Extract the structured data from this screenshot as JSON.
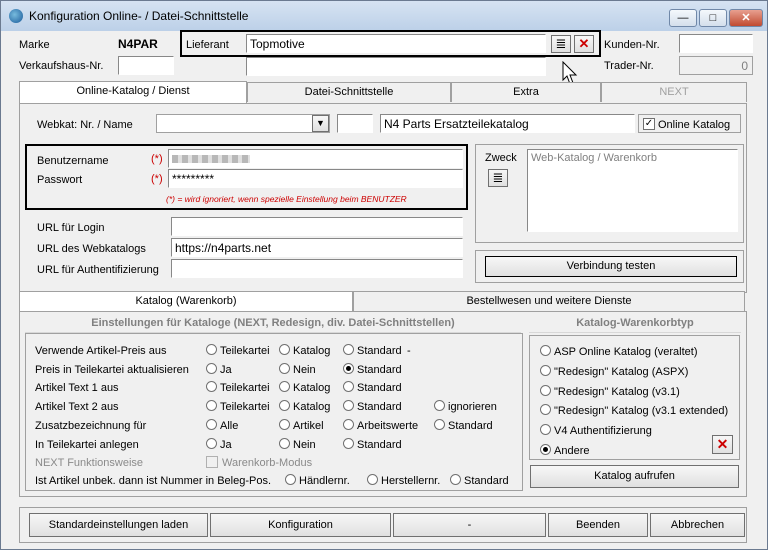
{
  "window": {
    "title": "Konfiguration Online- / Datei-Schnittstelle",
    "min_label": "—",
    "max_label": "□",
    "close_label": "✕"
  },
  "header": {
    "marke_label": "Marke",
    "marke_value": "N4PAR",
    "verkaufshaus_label": "Verkaufshaus-Nr.",
    "lieferant_label": "Lieferant",
    "lieferant_value": "Topmotive",
    "kunden_label": "Kunden-Nr.",
    "trader_label": "Trader-Nr.",
    "trader_value": "0",
    "list_glyph": "≣",
    "clear_glyph": "✕"
  },
  "main_tabs": [
    "Online-Katalog / Dienst",
    "Datei-Schnittstelle",
    "Extra",
    "NEXT"
  ],
  "webkat": {
    "label": "Webkat: Nr. / Name",
    "name_value": "N4 Parts Ersatzteilekatalog",
    "online_label": "Online Katalog",
    "online_checked": true,
    "check_glyph": "✓"
  },
  "auth": {
    "user_label": "Benutzername",
    "user_required": "(*)",
    "pass_label": "Passwort",
    "pass_required": "(*)",
    "pass_value": "*********",
    "note": "(*) = wird ignoriert, wenn spezielle Einstellung beim BENUTZER"
  },
  "zweck": {
    "label": "Zweck",
    "value": "Web-Katalog / Warenkorb"
  },
  "urls": {
    "login_label": "URL für Login",
    "webkat_label": "URL des Webkatalogs",
    "webkat_value": "https://n4parts.net",
    "auth_label": "URL für Authentifizierung"
  },
  "verbindung_label": "Verbindung testen",
  "sub_tabs": [
    "Katalog (Warenkorb)",
    "Bestellwesen und weitere Dienste"
  ],
  "settings": {
    "heading": "Einstellungen für Kataloge (NEXT, Redesign, div. Datei-Schnittstellen)",
    "rows": [
      {
        "label": "Verwende Artikel-Preis aus",
        "options": [
          "Teilekartei",
          "Katalog",
          "Standard"
        ],
        "extra": "-"
      },
      {
        "label": "Preis in Teilekartei aktualisieren",
        "options": [
          "Ja",
          "Nein",
          "Standard"
        ]
      },
      {
        "label": "Artikel Text 1 aus",
        "options": [
          "Teilekartei",
          "Katalog",
          "Standard"
        ]
      },
      {
        "label": "Artikel Text 2 aus",
        "options": [
          "Teilekartei",
          "Katalog",
          "Standard",
          "ignorieren"
        ]
      },
      {
        "label": "Zusatzbezeichnung für",
        "options": [
          "Alle",
          "Artikel",
          "Arbeitswerte",
          "Standard"
        ]
      },
      {
        "label": "In Teilekartei anlegen",
        "options": [
          "Ja",
          "Nein",
          "Standard"
        ]
      }
    ],
    "next_label": "NEXT Funktionsweise",
    "warenkorb_modus_label": "Warenkorb-Modus",
    "unbek_label": "Ist Artikel unbek. dann ist Nummer in Beleg-Pos.",
    "unbek_options": [
      "Händlernr.",
      "Herstellernr.",
      "Standard"
    ]
  },
  "katalog_typ": {
    "heading": "Katalog-Warenkorbtyp",
    "options": [
      "ASP Online Katalog (veraltet)",
      "\"Redesign\" Katalog (ASPX)",
      "\"Redesign\" Katalog (v3.1)",
      "\"Redesign\" Katalog (v3.1 extended)",
      "V4 Authentifizierung",
      "Andere"
    ],
    "selected": "Andere",
    "delete_glyph": "✕"
  },
  "katalog_aufrufen_label": "Katalog aufrufen",
  "footer": {
    "standard_label": "Standardeinstellungen laden",
    "konfig_label": "Konfiguration",
    "dash_label": "-",
    "beenden_label": "Beenden",
    "abbrechen_label": "Abbrechen"
  },
  "colors": {
    "required": "#cc0000",
    "title_bg": "#c8d8ec",
    "close_btn": "#c9503a"
  }
}
